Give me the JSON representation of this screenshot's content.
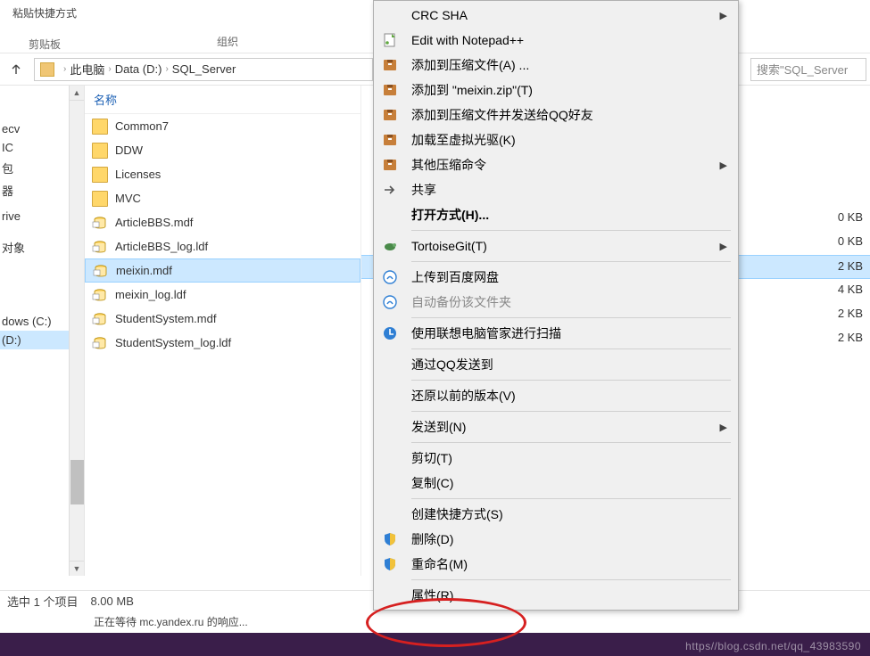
{
  "ribbon": {
    "paste_shortcut": "粘贴快捷方式",
    "clipboard_group": "剪贴板",
    "organize_group": "组织"
  },
  "breadcrumb": {
    "this_pc": "此电脑",
    "drive": "Data (D:)",
    "folder": "SQL_Server"
  },
  "search": {
    "placeholder": "搜索\"SQL_Server"
  },
  "columns": {
    "name": "名称"
  },
  "sidebar_partial": [
    "ecv",
    "IC",
    "包",
    "器",
    "",
    "rive",
    "",
    "",
    "对象",
    "",
    "",
    "",
    "",
    "",
    "",
    "",
    "",
    "",
    "",
    "dows (C:)"
  ],
  "sidebar_selected": "(D:)",
  "files": [
    {
      "name": "Common7",
      "type": "folder",
      "size": ""
    },
    {
      "name": "DDW",
      "type": "folder",
      "size": ""
    },
    {
      "name": "Licenses",
      "type": "folder",
      "size": ""
    },
    {
      "name": "MVC",
      "type": "folder",
      "size": ""
    },
    {
      "name": "ArticleBBS.mdf",
      "type": "db",
      "size": "0 KB"
    },
    {
      "name": "ArticleBBS_log.ldf",
      "type": "db",
      "size": "0 KB"
    },
    {
      "name": "meixin.mdf",
      "type": "db",
      "size": "2 KB",
      "selected": true
    },
    {
      "name": "meixin_log.ldf",
      "type": "db",
      "size": "4 KB"
    },
    {
      "name": "StudentSystem.mdf",
      "type": "db",
      "size": "2 KB"
    },
    {
      "name": "StudentSystem_log.ldf",
      "type": "db",
      "size": "2 KB"
    }
  ],
  "context_menu": [
    {
      "label": "CRC SHA",
      "icon": "",
      "arrow": true
    },
    {
      "label": "Edit with Notepad++",
      "icon": "notepad"
    },
    {
      "label": "添加到压缩文件(A) ...",
      "icon": "archive"
    },
    {
      "label": "添加到 \"meixin.zip\"(T)",
      "icon": "archive"
    },
    {
      "label": "添加到压缩文件并发送给QQ好友",
      "icon": "archive"
    },
    {
      "label": "加载至虚拟光驱(K)",
      "icon": "archive"
    },
    {
      "label": "其他压缩命令",
      "icon": "archive",
      "arrow": true
    },
    {
      "label": "共享",
      "icon": "share"
    },
    {
      "label": "打开方式(H)...",
      "icon": "",
      "bold": true
    },
    {
      "sep": true
    },
    {
      "label": "TortoiseGit(T)",
      "icon": "tortoise",
      "arrow": true
    },
    {
      "sep": true
    },
    {
      "label": "上传到百度网盘",
      "icon": "baidu"
    },
    {
      "label": "自动备份该文件夹",
      "icon": "baidu",
      "disabled": true
    },
    {
      "sep": true
    },
    {
      "label": "使用联想电脑管家进行扫描",
      "icon": "lenovo"
    },
    {
      "sep": true
    },
    {
      "label": "通过QQ发送到",
      "icon": ""
    },
    {
      "sep": true
    },
    {
      "label": "还原以前的版本(V)",
      "icon": ""
    },
    {
      "sep": true
    },
    {
      "label": "发送到(N)",
      "icon": "",
      "arrow": true
    },
    {
      "sep": true
    },
    {
      "label": "剪切(T)",
      "icon": ""
    },
    {
      "label": "复制(C)",
      "icon": ""
    },
    {
      "sep": true
    },
    {
      "label": "创建快捷方式(S)",
      "icon": ""
    },
    {
      "label": "删除(D)",
      "icon": "shield"
    },
    {
      "label": "重命名(M)",
      "icon": "shield"
    },
    {
      "sep": true
    },
    {
      "label": "属性(R)",
      "icon": ""
    }
  ],
  "status": {
    "selected_items": "选中 1 个项目",
    "size": "8.00 MB"
  },
  "loading": "正在等待 mc.yandex.ru 的响应...",
  "watermark": "https//blog.csdn.net/qq_43983590"
}
